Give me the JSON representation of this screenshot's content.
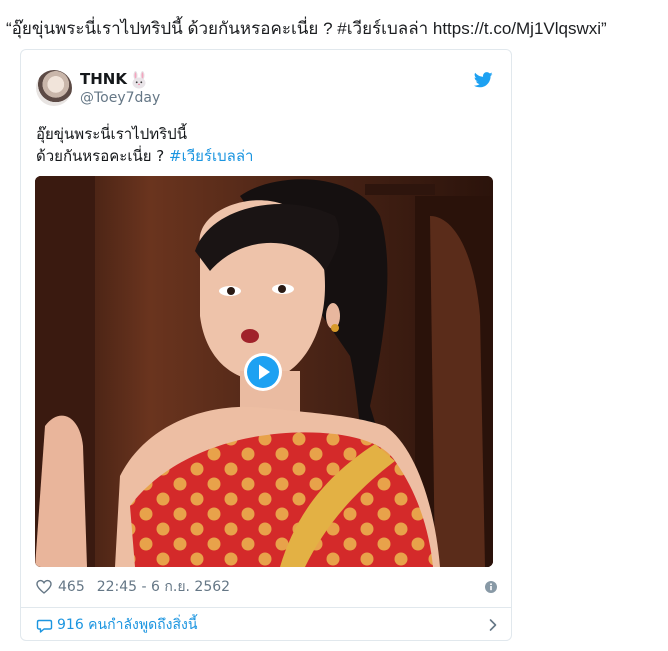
{
  "embed_header": {
    "quote_text": "“อุ๊ยขุ่นพระนี่เราไปทริปนี้ ด้วยกันหรอคะเนี่ย ? #เวียร์เบลล่า https://t.co/Mj1Vlqswxi”"
  },
  "tweet": {
    "author_name": "THNK",
    "author_emoji_icon": "rabbit-face-icon",
    "author_handle": "@Toey7day",
    "text_line1": "อุ๊ยขุ่นพระนี่เราไปทริปนี้",
    "text_line2_plain": "ด้วยกันหรอคะเนี่ย ? ",
    "text_line2_hashtag": "#เวียร์เบลล่า",
    "media_icon": "play-icon",
    "likes": "465",
    "timestamp": "22:45 - 6 ก.ย. 2562",
    "replies_label": "916 คนกำลังพูดถึงสิ่งนี้"
  },
  "colors": {
    "accent": "#1b95e0",
    "twitter_brand": "#1da1f2",
    "muted": "#657786",
    "border": "#e1e8ed"
  }
}
